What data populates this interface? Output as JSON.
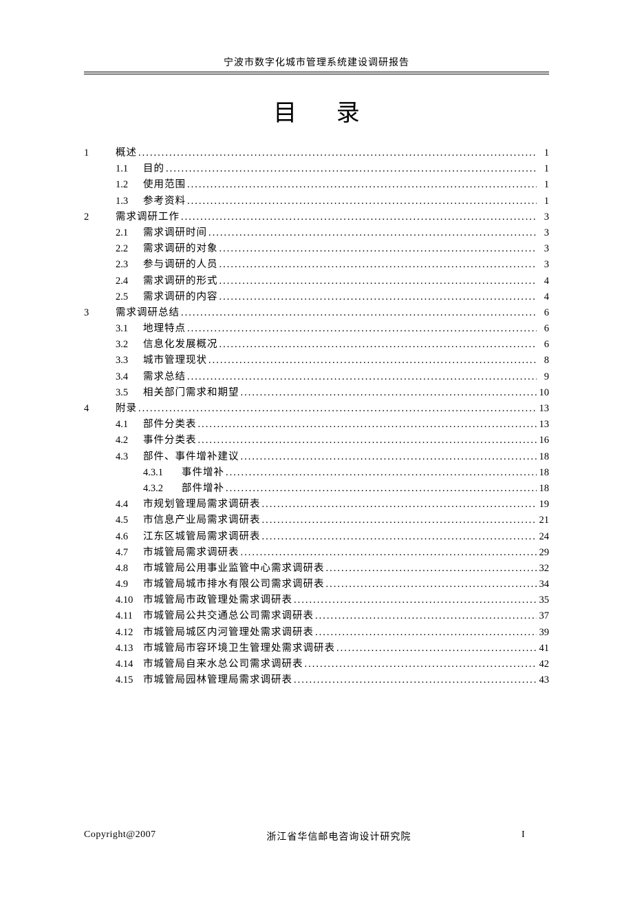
{
  "header": "宁波市数字化城市管理系统建设调研报告",
  "title": "目 录",
  "toc": [
    {
      "level": 1,
      "num": "1",
      "label": "概述",
      "page": "1"
    },
    {
      "level": 2,
      "num": "1.1",
      "label": "目的",
      "page": "1"
    },
    {
      "level": 2,
      "num": "1.2",
      "label": "使用范围",
      "page": "1"
    },
    {
      "level": 2,
      "num": "1.3",
      "label": "参考资料",
      "page": "1"
    },
    {
      "level": 1,
      "num": "2",
      "label": "需求调研工作",
      "page": "3"
    },
    {
      "level": 2,
      "num": "2.1",
      "label": "需求调研时间",
      "page": "3"
    },
    {
      "level": 2,
      "num": "2.2",
      "label": "需求调研的对象",
      "page": "3"
    },
    {
      "level": 2,
      "num": "2.3",
      "label": "参与调研的人员",
      "page": "3"
    },
    {
      "level": 2,
      "num": "2.4",
      "label": "需求调研的形式",
      "page": "4"
    },
    {
      "level": 2,
      "num": "2.5",
      "label": "需求调研的内容",
      "page": "4"
    },
    {
      "level": 1,
      "num": "3",
      "label": "需求调研总结",
      "page": "6"
    },
    {
      "level": 2,
      "num": "3.1",
      "label": "地理特点",
      "page": "6"
    },
    {
      "level": 2,
      "num": "3.2",
      "label": "信息化发展概况",
      "page": "6"
    },
    {
      "level": 2,
      "num": "3.3",
      "label": "城市管理现状",
      "page": "8"
    },
    {
      "level": 2,
      "num": "3.4",
      "label": "需求总结",
      "page": "9"
    },
    {
      "level": 2,
      "num": "3.5",
      "label": "相关部门需求和期望",
      "page": "10"
    },
    {
      "level": 1,
      "num": "4",
      "label": "附录",
      "page": "13"
    },
    {
      "level": 2,
      "num": "4.1",
      "label": "部件分类表",
      "page": "13"
    },
    {
      "level": 2,
      "num": "4.2",
      "label": "事件分类表",
      "page": "16"
    },
    {
      "level": 2,
      "num": "4.3",
      "label": "部件、事件增补建议",
      "page": "18"
    },
    {
      "level": 3,
      "num": "4.3.1",
      "label": "事件增补",
      "page": "18"
    },
    {
      "level": 3,
      "num": "4.3.2",
      "label": "部件增补",
      "page": "18"
    },
    {
      "level": 2,
      "num": "4.4",
      "label": "市规划管理局需求调研表",
      "page": "19"
    },
    {
      "level": 2,
      "num": "4.5",
      "label": "市信息产业局需求调研表",
      "page": "21"
    },
    {
      "level": 2,
      "num": "4.6",
      "label": "江东区城管局需求调研表",
      "page": "24"
    },
    {
      "level": 2,
      "num": "4.7",
      "label": "市城管局需求调研表",
      "page": "29"
    },
    {
      "level": 2,
      "num": "4.8",
      "label": "市城管局公用事业监管中心需求调研表",
      "page": "32"
    },
    {
      "level": 2,
      "num": "4.9",
      "label": "市城管局城市排水有限公司需求调研表",
      "page": "34"
    },
    {
      "level": 2,
      "num": "4.10",
      "label": "市城管局市政管理处需求调研表",
      "page": "35"
    },
    {
      "level": 2,
      "num": "4.11",
      "label": "市城管局公共交通总公司需求调研表",
      "page": "37"
    },
    {
      "level": 2,
      "num": "4.12",
      "label": "市城管局城区内河管理处需求调研表",
      "page": "39"
    },
    {
      "level": 2,
      "num": "4.13",
      "label": "市城管局市容环境卫生管理处需求调研表",
      "page": "41"
    },
    {
      "level": 2,
      "num": "4.14",
      "label": "市城管局自来水总公司需求调研表",
      "page": "42"
    },
    {
      "level": 2,
      "num": "4.15",
      "label": "市城管局园林管理局需求调研表",
      "page": "43"
    }
  ],
  "footer": {
    "left": "Copyright@2007",
    "center": "浙江省华信邮电咨询设计研究院",
    "right": "I"
  }
}
